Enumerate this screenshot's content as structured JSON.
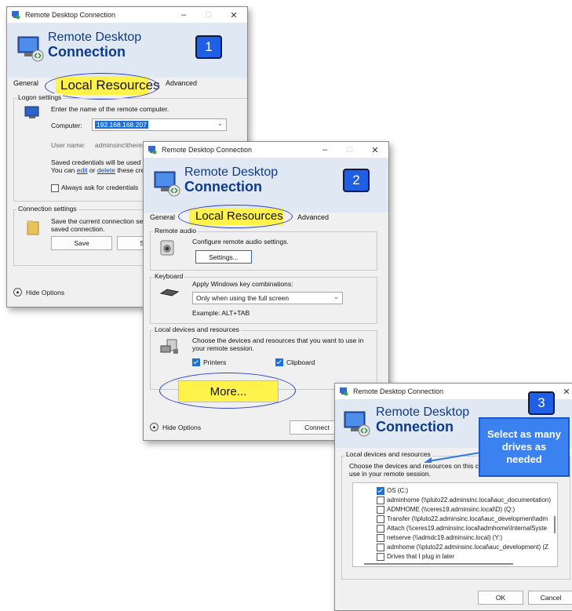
{
  "window1": {
    "title": "Remote Desktop Connection",
    "banner_line1": "Remote Desktop",
    "banner_line2": "Connection",
    "step": "1",
    "tabs": {
      "general": "General",
      "local": "Local Resources",
      "advanced": "Advanced"
    },
    "logon_label": "Logon settings",
    "enter_name": "Enter the name of the remote computer.",
    "computer_label": "Computer:",
    "computer_value": "192.168.168.207",
    "user_label": "User name:",
    "user_value": "adminsinc\\therese",
    "saved_line1": "Saved credentials will be used to",
    "saved_line2_pre": "You can",
    "saved_edit": "edit",
    "saved_or": "or",
    "saved_delete": "delete",
    "saved_line2_post": "these cred",
    "always_ask": "Always ask for credentials",
    "conn_label": "Connection settings",
    "conn_line1": "Save the current connection set",
    "conn_line2": "saved connection.",
    "save": "Save",
    "save_as": "Save",
    "hide_options": "Hide Options"
  },
  "window2": {
    "title": "Remote Desktop Connection",
    "banner_line1": "Remote Desktop",
    "banner_line2": "Connection",
    "step": "2",
    "tabs": {
      "general": "General",
      "local": "Local Resources",
      "advanced": "Advanced"
    },
    "remote_audio_label": "Remote audio",
    "audio_text": "Configure remote audio settings.",
    "settings": "Settings...",
    "keyboard_label": "Keyboard",
    "apply_keys": "Apply Windows key combinations:",
    "key_option": "Only when using the full screen",
    "example": "Example: ALT+TAB",
    "local_devices_label": "Local devices and resources",
    "choose_line1": "Choose the devices and resources that you want to use in",
    "choose_line2": "your remote session.",
    "printers": "Printers",
    "clipboard": "Clipboard",
    "more": "More...",
    "hide_options": "Hide Options",
    "connect": "Connect"
  },
  "window3": {
    "title": "Remote Desktop Connection",
    "banner_line1": "Remote Desktop",
    "banner_line2": "Connection",
    "step": "3",
    "callout": "Select as many drives as needed",
    "local_devices_label": "Local devices and resources",
    "choose_line1": "Choose the devices and resources on this co",
    "choose_line2": "use in your remote session.",
    "drives": [
      {
        "label": "OS (C:)",
        "checked": true
      },
      {
        "label": "adminhome (\\\\pluto22.adminsinc.local\\auc_documentation)",
        "checked": false
      },
      {
        "label": "ADMHOME (\\\\ceres19.adminsinc.local\\D) (Q:)",
        "checked": false
      },
      {
        "label": "Transfer (\\\\pluto22.adminsinc.local\\auc_development\\adm",
        "checked": false
      },
      {
        "label": "Attach (\\\\ceres19.adminsinc.local\\admhome\\InternalSyste",
        "checked": false
      },
      {
        "label": "netserve (\\\\admdc19.adminsinc.local) (Y:)",
        "checked": false
      },
      {
        "label": "admhome (\\\\pluto22.adminsinc.local\\auc_development) (Z",
        "checked": false
      },
      {
        "label": "Drives that I plug in later",
        "checked": false
      }
    ],
    "ok": "OK",
    "cancel": "Cancel"
  },
  "colors": {
    "accent": "#1f5fe6",
    "highlight": "#fff24a",
    "circle": "#2b3fd1",
    "banner_text": "#0d3a8a"
  }
}
